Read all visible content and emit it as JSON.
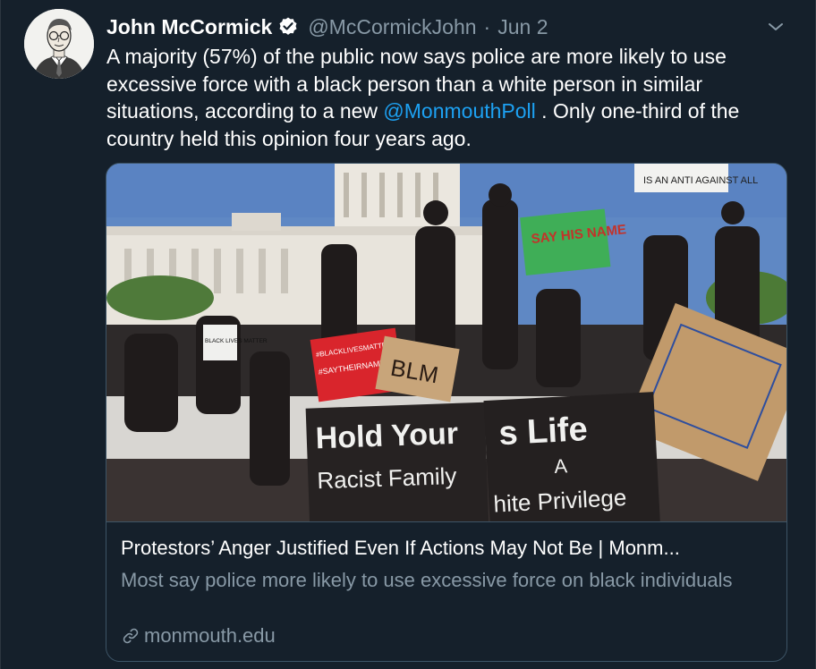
{
  "tweet": {
    "display_name": "John McCormick",
    "handle": "@McCormickJohn",
    "separator": "·",
    "date": "Jun 2",
    "text_before_mention": "A majority (57%) of the public now says police are more likely to use excessive force with a black person than a white person in similar situations, according to a new ",
    "mention": "@MonmouthPoll",
    "text_after_mention": " . Only one-third of the country held this opinion four years ago."
  },
  "card": {
    "image_signs": {
      "sign_top_right": "IS AN ANTI AGAINST ALL",
      "sign_say_his_name": "SAY HIS NAME",
      "sign_black_lives": "BLACK LIVES MATTER",
      "sign_blackLivesMatter_hashtag": "#BLACKLIVESMATTER",
      "sign_saytheirname": "#SAYTHEIRNAME",
      "sign_blm": "BLM",
      "banner_left_line1": "Hold Your",
      "banner_left_line2": "Racist Family",
      "banner_right_line1": "s Life",
      "banner_right_line2": "A",
      "banner_right_line3": "hite Privilege"
    },
    "title": "Protestors’ Anger Justified Even If Actions May Not Be | Monm...",
    "description": "Most say police more likely to use excessive force on black individuals",
    "domain": "monmouth.edu"
  },
  "colors": {
    "background": "#15202b",
    "text": "#ffffff",
    "secondary": "#8899a6",
    "link": "#1da1f2",
    "border": "#3d5466"
  },
  "icons": {
    "verified": "verified-badge-icon",
    "caret": "chevron-down-icon",
    "link": "link-icon"
  }
}
